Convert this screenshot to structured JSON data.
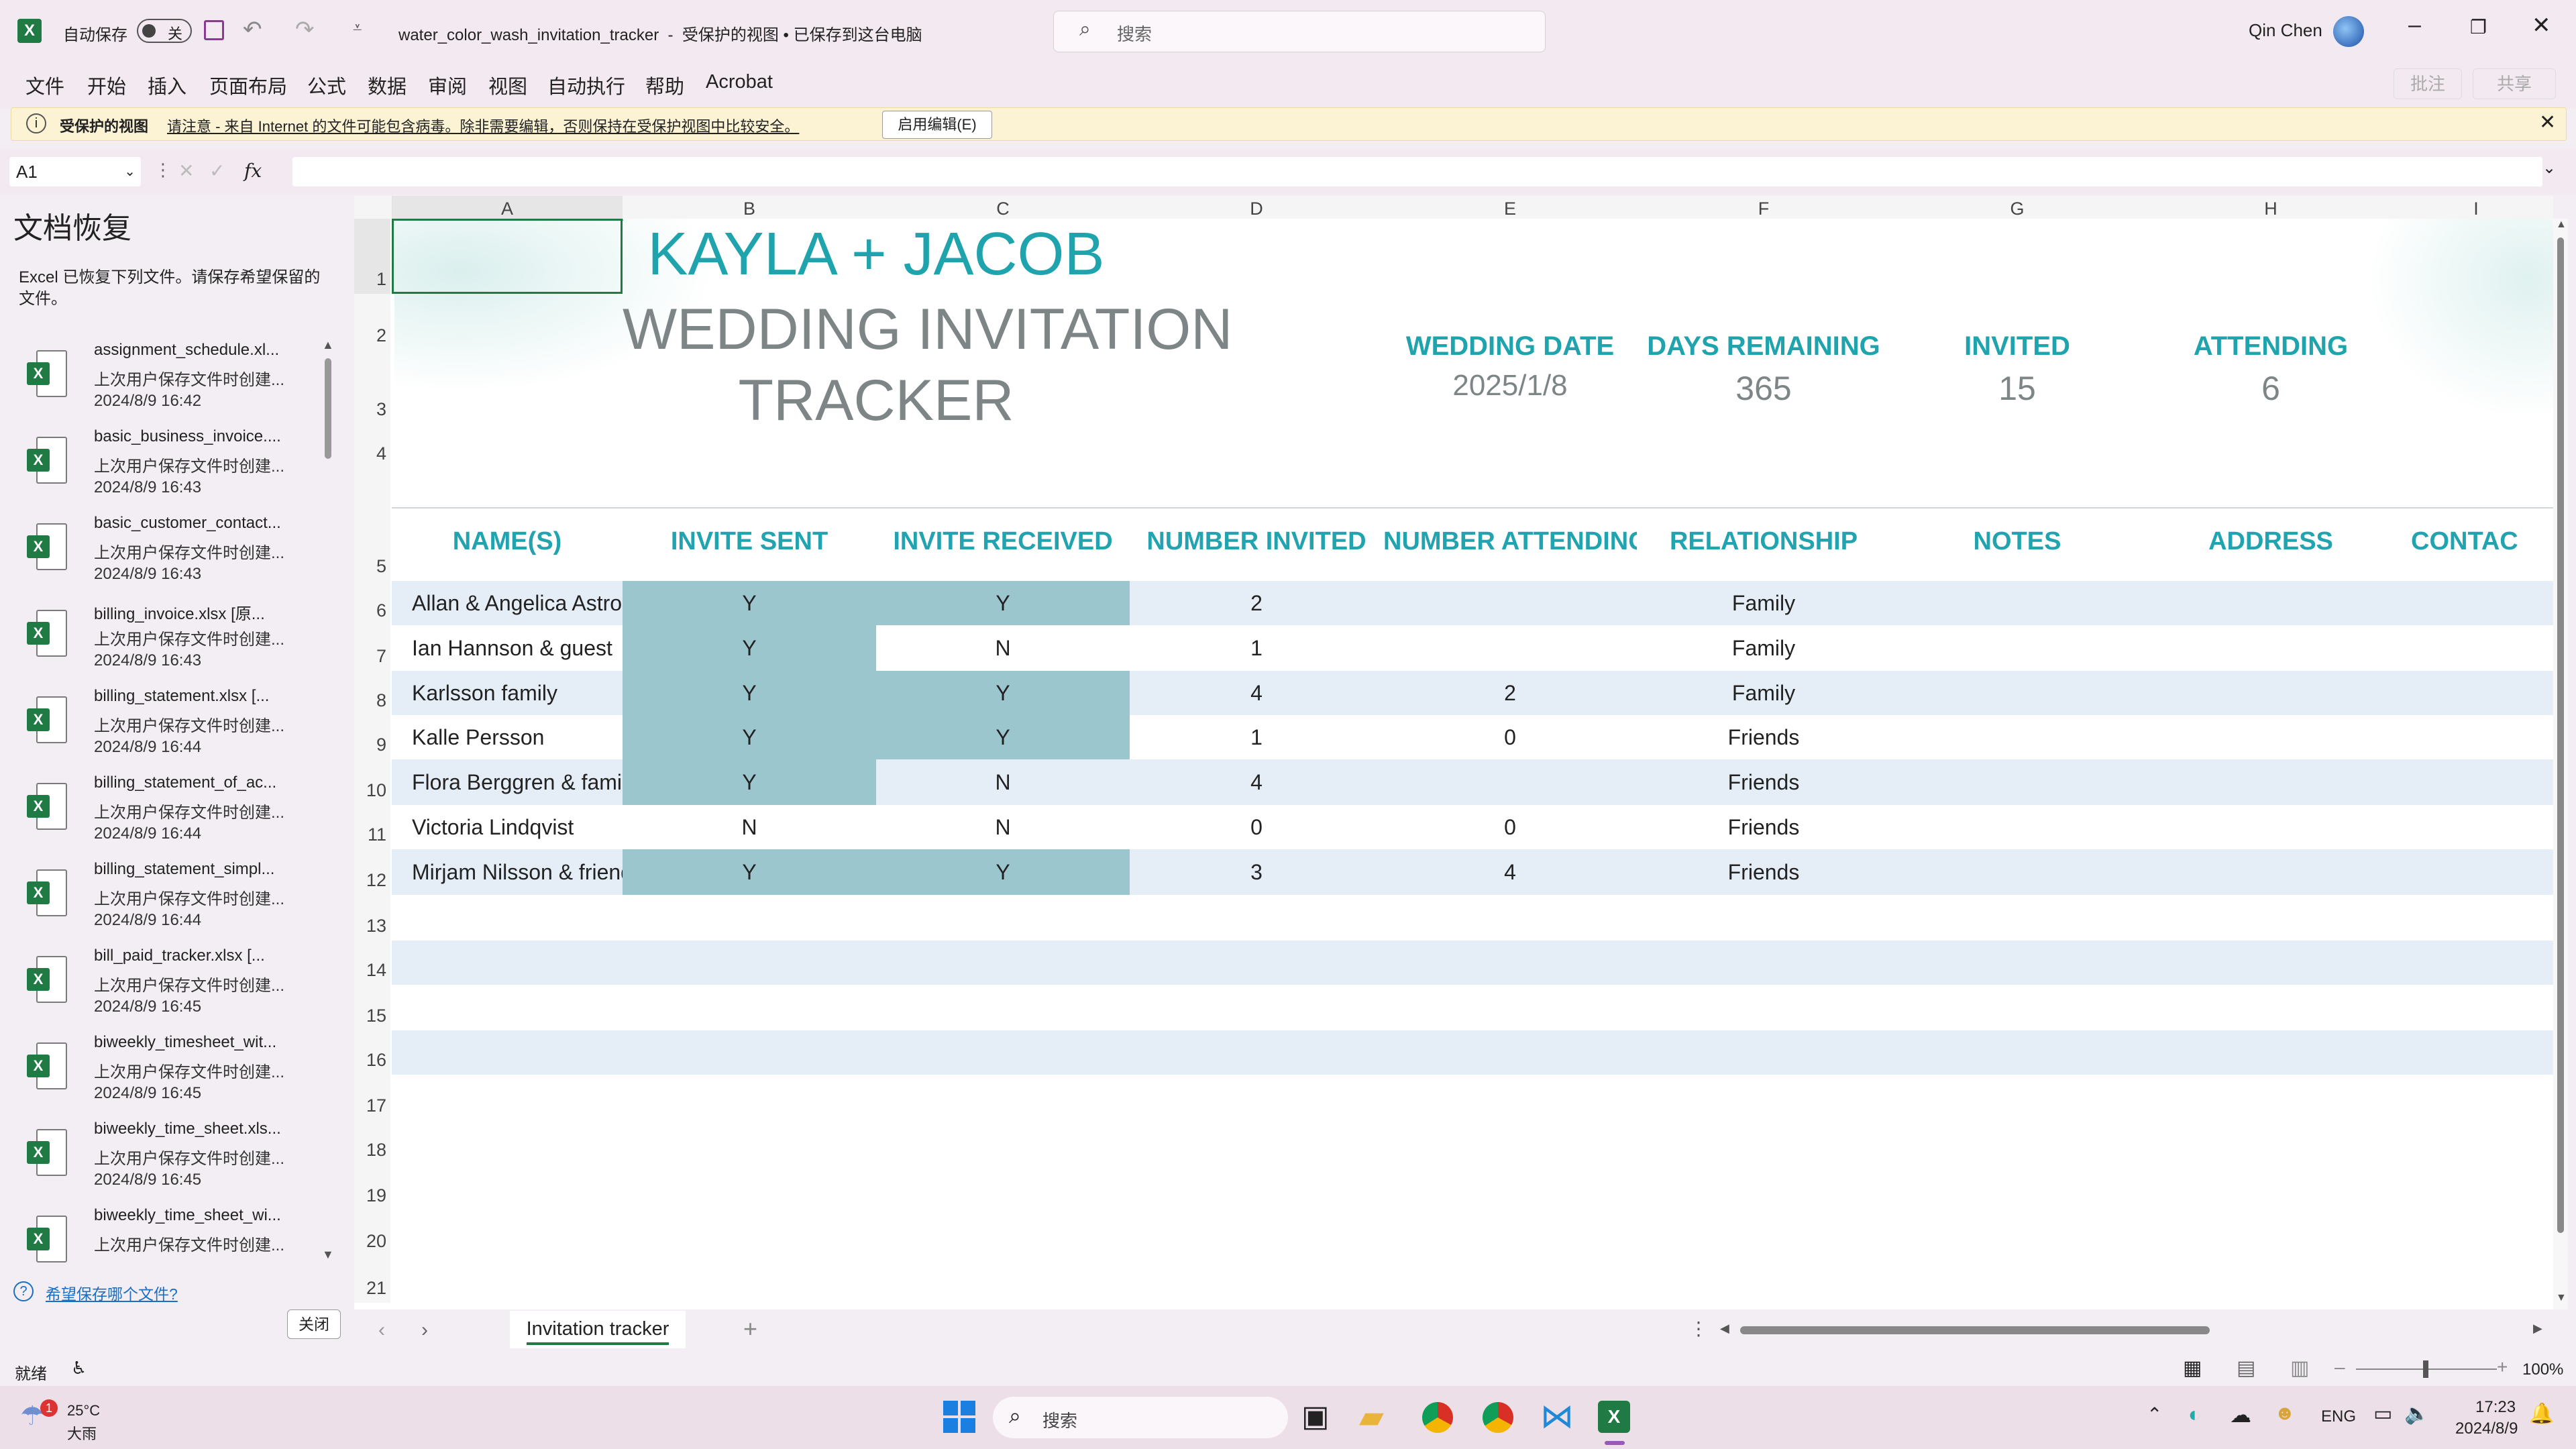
{
  "titlebar": {
    "autosave_label": "自动保存",
    "autosave_state": "关",
    "doc_title": "water_color_wash_invitation_tracker  -  受保护的视图 • 已保存到这台电脑",
    "search_placeholder": "搜索",
    "user_name": "Qin Chen"
  },
  "menu": [
    "文件",
    "开始",
    "插入",
    "页面布局",
    "公式",
    "数据",
    "审阅",
    "视图",
    "自动执行",
    "帮助",
    "Acrobat"
  ],
  "ribbon_right": {
    "comment": "批注",
    "share": "共享"
  },
  "protected_bar": {
    "title": "受保护的视图",
    "message": "请注意 - 来自 Internet 的文件可能包含病毒。除非需要编辑，否则保持在受保护视图中比较安全。",
    "button": "启用编辑(E)"
  },
  "formula_bar": {
    "name_box": "A1",
    "fx": "fx",
    "content": ""
  },
  "recovery": {
    "title": "文档恢复",
    "subtitle": "Excel 已恢复下列文件。请保存希望保留的文件。",
    "items": [
      {
        "name": "assignment_schedule.xl...",
        "desc": "上次用户保存文件时创建...",
        "time": "2024/8/9 16:42"
      },
      {
        "name": "basic_business_invoice....",
        "desc": "上次用户保存文件时创建...",
        "time": "2024/8/9 16:43"
      },
      {
        "name": "basic_customer_contact...",
        "desc": "上次用户保存文件时创建...",
        "time": "2024/8/9 16:43"
      },
      {
        "name": "billing_invoice.xlsx  [原...",
        "desc": "上次用户保存文件时创建...",
        "time": "2024/8/9 16:43"
      },
      {
        "name": "billing_statement.xlsx  [...",
        "desc": "上次用户保存文件时创建...",
        "time": "2024/8/9 16:44"
      },
      {
        "name": "billing_statement_of_ac...",
        "desc": "上次用户保存文件时创建...",
        "time": "2024/8/9 16:44"
      },
      {
        "name": "billing_statement_simpl...",
        "desc": "上次用户保存文件时创建...",
        "time": "2024/8/9 16:44"
      },
      {
        "name": "bill_paid_tracker.xlsx  [...",
        "desc": "上次用户保存文件时创建...",
        "time": "2024/8/9 16:45"
      },
      {
        "name": "biweekly_timesheet_wit...",
        "desc": "上次用户保存文件时创建...",
        "time": "2024/8/9 16:45"
      },
      {
        "name": "biweekly_time_sheet.xls...",
        "desc": "上次用户保存文件时创建...",
        "time": "2024/8/9 16:45"
      },
      {
        "name": "biweekly_time_sheet_wi...",
        "desc": "上次用户保存文件时创建...",
        "time": ""
      }
    ],
    "help_link": "希望保存哪个文件?",
    "close_button": "关闭"
  },
  "sheet": {
    "columns": [
      "A",
      "B",
      "C",
      "D",
      "E",
      "F",
      "G",
      "H",
      "I"
    ],
    "rows": [
      "1",
      "2",
      "3",
      "4",
      "5",
      "6",
      "7",
      "8",
      "9",
      "10",
      "11",
      "12",
      "13",
      "14",
      "15",
      "16",
      "17",
      "18",
      "19",
      "20",
      "21"
    ],
    "title_line1": "KAYLA + JACOB",
    "title_line2": "WEDDING INVITATION",
    "title_line3": "TRACKER",
    "stats": [
      {
        "label": "WEDDING DATE",
        "value": "2025/1/8"
      },
      {
        "label": "DAYS REMAINING",
        "value": "365"
      },
      {
        "label": "INVITED",
        "value": "15"
      },
      {
        "label": "ATTENDING",
        "value": "6"
      }
    ],
    "headers": [
      "NAME(S)",
      "INVITE SENT",
      "INVITE RECEIVED",
      "NUMBER INVITED",
      "NUMBER ATTENDING",
      "RELATIONSHIP",
      "NOTES",
      "ADDRESS",
      "CONTAC"
    ],
    "data": [
      {
        "name": "Allan & Angelica Astrom",
        "sent": "Y",
        "received": "Y",
        "invited": "2",
        "attending": "",
        "relationship": "Family"
      },
      {
        "name": "Ian Hannson & guest",
        "sent": "Y",
        "received": "N",
        "invited": "1",
        "attending": "",
        "relationship": "Family"
      },
      {
        "name": "Karlsson family",
        "sent": "Y",
        "received": "Y",
        "invited": "4",
        "attending": "2",
        "relationship": "Family"
      },
      {
        "name": "Kalle Persson",
        "sent": "Y",
        "received": "Y",
        "invited": "1",
        "attending": "0",
        "relationship": "Friends"
      },
      {
        "name": "Flora Berggren & family",
        "sent": "Y",
        "received": "N",
        "invited": "4",
        "attending": "",
        "relationship": "Friends"
      },
      {
        "name": "Victoria Lindqvist",
        "sent": "N",
        "received": "N",
        "invited": "0",
        "attending": "0",
        "relationship": "Friends"
      },
      {
        "name": "Mirjam Nilsson & friend",
        "sent": "Y",
        "received": "Y",
        "invited": "3",
        "attending": "4",
        "relationship": "Friends"
      }
    ]
  },
  "tabs": {
    "active": "Invitation tracker"
  },
  "status": {
    "ready": "就绪",
    "zoom": "100%"
  },
  "taskbar": {
    "weather_temp": "25°C",
    "weather_desc": "大雨",
    "search": "搜索",
    "lang": "ENG",
    "time": "17:23",
    "date": "2024/8/9"
  },
  "colors": {
    "accent_teal": "#22a3b0",
    "shade_teal": "#9cc6cd",
    "band": "#e5eef7",
    "excel_green": "#1f7a43"
  }
}
